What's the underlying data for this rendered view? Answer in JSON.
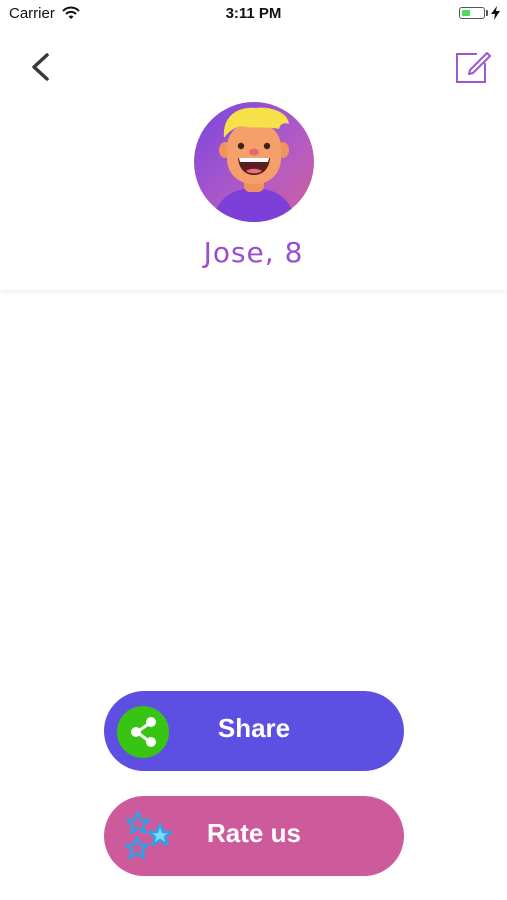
{
  "status_bar": {
    "carrier": "Carrier",
    "time": "3:11 PM",
    "battery_level": 0.4,
    "battery_color": "#4cd964"
  },
  "header": {
    "back_icon": "chevron-left-icon",
    "edit_icon": "edit-icon",
    "profile_name": "Jose, 8"
  },
  "actions": {
    "share_label": "Share",
    "share_icon": "share-icon",
    "rate_label": "Rate us",
    "rate_icon": "stars-icon"
  },
  "colors": {
    "share_button": "#5e4fe3",
    "share_icon_bg": "#38c413",
    "rate_button": "#cd5a9b",
    "name_text": "#9b4fd0",
    "edit_icon": "#9b59d0"
  }
}
